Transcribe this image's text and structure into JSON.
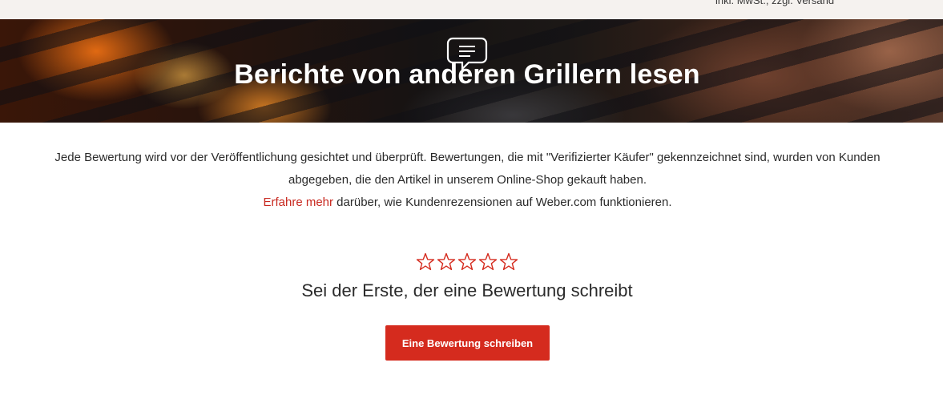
{
  "top_bar": {
    "tax_note": "inkl. MwSt., zzgl. Versand"
  },
  "hero": {
    "icon": "chat-bubble-icon",
    "title": "Berichte von anderen Grillern lesen"
  },
  "disclaimer": {
    "text": "Jede Bewertung wird vor der Veröffentlichung gesichtet und überprüft. Bewertungen, die mit \"Verifizierter Käufer\" gekennzeichnet sind, wurden von Kunden abgegeben, die den Artikel in unserem Online-Shop gekauft haben.",
    "link_label": "Erfahre mehr",
    "link_suffix": " darüber, wie Kundenrezensionen auf Weber.com funktionieren."
  },
  "rating": {
    "stars_filled": 0,
    "stars_total": 5,
    "star_color": "#d52b1e",
    "empty_state_text": "Sei der Erste, der eine Bewertung schreibt"
  },
  "actions": {
    "write_review_label": "Eine Bewertung schreiben"
  },
  "colors": {
    "accent": "#d52b1e",
    "link": "#c8281f"
  }
}
